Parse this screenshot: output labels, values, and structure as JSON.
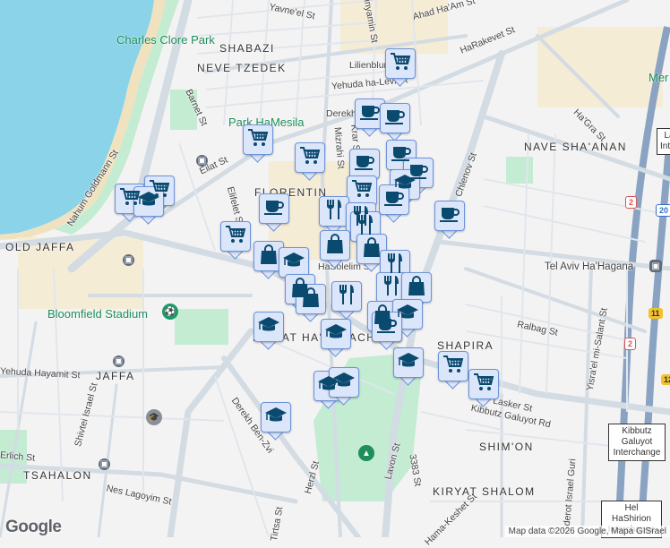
{
  "map": {
    "neighborhoods": [
      "SHABAZI",
      "NEVE TZEDEK",
      "FLORENTIN",
      "OLD JAFFA",
      "NAVE SHA'ANAN",
      "JAFFA",
      "SHAPIRA",
      "TSAHALON",
      "SHIM'ON",
      "KIRYAT SHALOM",
      "KIRYAT HA'MELACHA"
    ],
    "parks": [
      "Charles Clore Park",
      "Park HaMesila",
      "Bloomfield Stadium",
      "Mer"
    ],
    "streets": [
      "Yavne'el St",
      "Ahad Ha'Am St",
      "Binyamin St",
      "HaRakevet St",
      "Lilienblum St",
      "Yehuda ha-Levi St",
      "Barnet St",
      "Eilat St",
      "Nahum Goldmann St",
      "Elifelet St",
      "Derekh",
      "Mizrahi St",
      "Krar St",
      "Chlenov St",
      "Ha'Gra St",
      "HaSolelim St",
      "Yehuda Hayamit St",
      "Shivtei Israel St",
      "Erlich St",
      "Nes Lagoyim St",
      "Derekh Ben-Zvi",
      "Herzl St",
      "Lavon St",
      "3383 St",
      "Ralbag St",
      "Kibbutz Galuyot Rd",
      "Lasker St",
      "Yisra'el mi-Salant St",
      "Sderot Israel Guri",
      "Hama-Keshet St",
      "Tirtsa St",
      "Tel Aviv Ha'Hagana"
    ],
    "interchanges": [
      "La Inter",
      "Kibbutz Galuyot Interchange",
      "Hel HaShirion Interchange"
    ],
    "route_shields": [
      {
        "label": "2",
        "color": "#d9534f"
      },
      {
        "label": "20",
        "color": "#3a6fc4"
      },
      {
        "label": "11",
        "color": "#f2c12e"
      },
      {
        "label": "2",
        "color": "#d9534f"
      },
      {
        "label": "12",
        "color": "#f2c12e"
      }
    ],
    "markers": [
      "cart",
      "cart",
      "graduation",
      "cart",
      "cart",
      "cart",
      "cart",
      "coffee",
      "coffee",
      "coffee",
      "coffee",
      "coffee",
      "coffee",
      "cart",
      "graduation",
      "coffee",
      "fork-knife",
      "fork-knife",
      "fork-knife",
      "coffee",
      "coffee",
      "bag",
      "bag",
      "graduation",
      "bag",
      "fork-knife",
      "fork-knife",
      "bag",
      "bag",
      "bag",
      "fork-knife",
      "bag",
      "graduation",
      "graduation",
      "graduation",
      "coffee",
      "graduation",
      "graduation",
      "graduation",
      "graduation",
      "cart",
      "cart"
    ],
    "marker_color": "#0b4a6f"
  },
  "footer": {
    "logo": "Google",
    "attribution": "Map data ©2026 Google, Mapa GISrael"
  }
}
